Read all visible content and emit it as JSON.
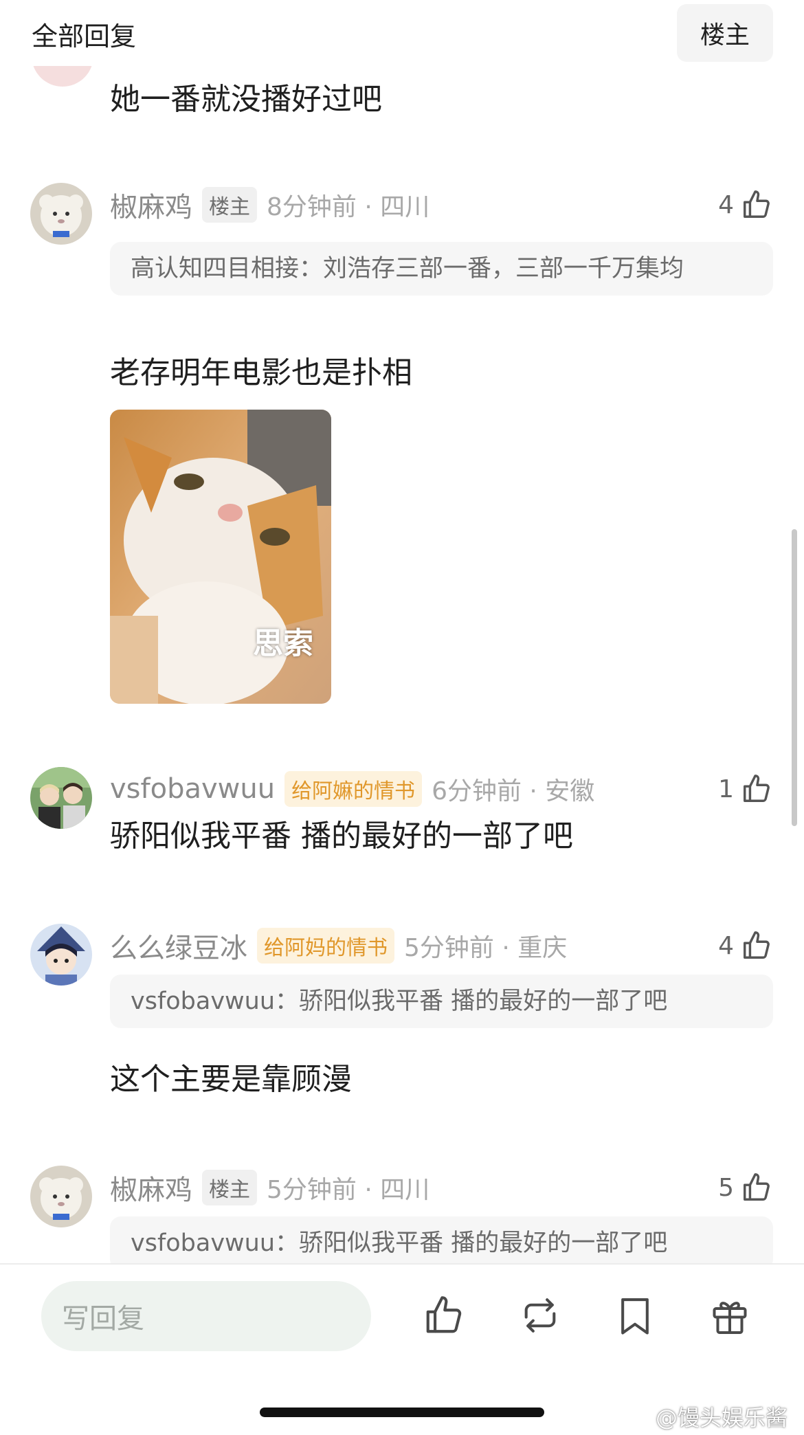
{
  "header": {
    "title": "全部回复",
    "op_button": "楼主"
  },
  "previous_comment": {
    "text": "她一番就没播好过吧"
  },
  "comments": [
    {
      "username": "椒麻鸡",
      "badge": "楼主",
      "time_location": "8分钟前 · 四川",
      "likes": "4",
      "quote": "高认知四目相接：刘浩存三部一番，三部一千万集均",
      "text": "老存明年电影也是扑相",
      "sticker_caption": "思索"
    },
    {
      "username": "vsfobavwuu",
      "badge": "给阿嫲的情书",
      "time_location": "6分钟前 · 安徽",
      "likes": "1",
      "text": "骄阳似我平番 播的最好的一部了吧"
    },
    {
      "username": "么么绿豆冰",
      "badge": "给阿妈的情书",
      "time_location": "5分钟前 · 重庆",
      "likes": "4",
      "quote_author": "vsfobavwuu：",
      "quote_text": "骄阳似我平番 播的最好的一部了吧",
      "text": "这个主要是靠顾漫"
    },
    {
      "username": "椒麻鸡",
      "badge": "楼主",
      "time_location": "5分钟前 · 四川",
      "likes": "5",
      "quote_author": "vsfobavwuu：",
      "quote_text": "骄阳似我平番 播的最好的一部了吧"
    }
  ],
  "bottom_bar": {
    "reply_placeholder": "写回复",
    "icons": [
      "like-icon",
      "repost-icon",
      "bookmark-icon",
      "gift-icon"
    ]
  },
  "watermark": "@馒头娱乐酱",
  "colors": {
    "fan_badge": "#e0972a",
    "reply_input_bg": "#eef3ef"
  }
}
